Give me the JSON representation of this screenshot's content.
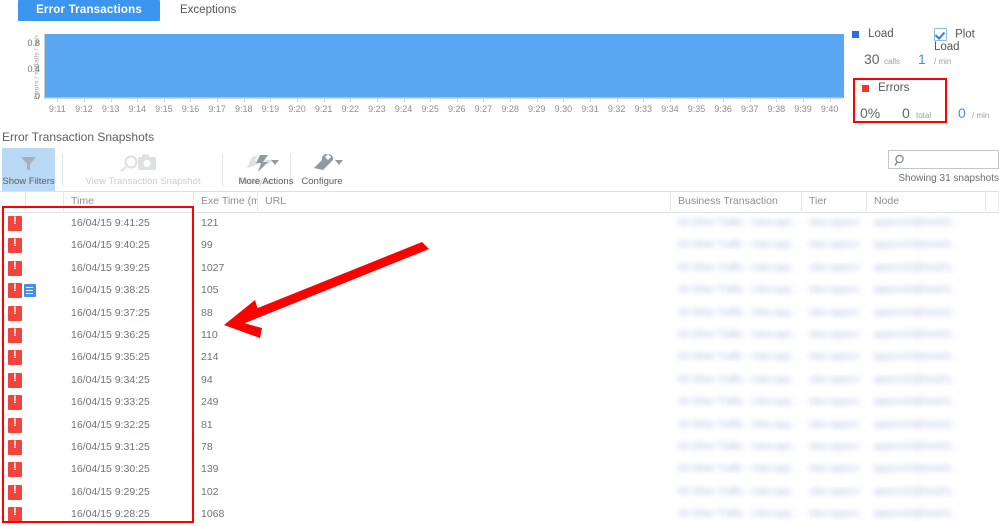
{
  "tabs": [
    {
      "label": "Error Transactions",
      "active": true
    },
    {
      "label": "Exceptions",
      "active": false
    }
  ],
  "chart_data": {
    "type": "area",
    "title": "",
    "xlabel": "",
    "ylabel": "Calls / min",
    "ylabel2": "Errors / min",
    "ylim": [
      0,
      1.0
    ],
    "yticks": [
      "0.8",
      "0.4",
      "0"
    ],
    "grid": false,
    "x": [
      "9:11",
      "9:12",
      "9:13",
      "9:14",
      "9:15",
      "9:16",
      "9:17",
      "9:18",
      "9:19",
      "9:20",
      "9:21",
      "9:22",
      "9:23",
      "9:24",
      "9:25",
      "9:26",
      "9:27",
      "9:28",
      "9:29",
      "9:30",
      "9:31",
      "9:32",
      "9:33",
      "9:34",
      "9:35",
      "9:36",
      "9:37",
      "9:38",
      "9:39",
      "9:40"
    ],
    "series": [
      {
        "name": "Load",
        "color": "#5aa7f3",
        "values": [
          1,
          1,
          1,
          1,
          1,
          1,
          1,
          1,
          1,
          1,
          1,
          1,
          1,
          1,
          1,
          1,
          1,
          1,
          1,
          1,
          1,
          1,
          1,
          1,
          1,
          1,
          1,
          1,
          1,
          1
        ]
      },
      {
        "name": "Errors",
        "color": "#f2a5a5",
        "values": [
          0,
          0,
          0,
          0,
          0,
          0,
          0,
          0,
          0,
          0,
          0,
          0,
          0,
          0,
          0,
          0,
          0,
          0,
          0,
          0,
          0,
          0,
          0,
          0,
          0,
          0,
          0,
          0,
          0,
          0
        ]
      }
    ],
    "legend_position": "right"
  },
  "metrics": {
    "load": {
      "marker_color": "#2e6fd9",
      "label": "Load",
      "checkbox_label": "Plot Load",
      "checkbox_checked": true,
      "value": "30",
      "value_unit": "calls",
      "rate": "1",
      "rate_unit": "/ min"
    },
    "errors": {
      "marker_color": "#f0352e",
      "label": "Errors",
      "percent": "0%",
      "total": "0",
      "total_unit": "total",
      "rate": "0",
      "rate_unit": "/ min",
      "highlight_color": "#ff0000"
    }
  },
  "section": {
    "title": "Error Transaction Snapshots"
  },
  "toolbar": {
    "items": [
      {
        "label": "Show Filters",
        "icon": "filter-funnel-icon",
        "state": "active"
      },
      {
        "label": "View Transaction Snapshot",
        "icon": "magnifier-camera-icon",
        "state": "disabled"
      },
      {
        "label": "Analyze",
        "icon": "analyze-icon",
        "state": "disabled"
      },
      {
        "label": "More Actions",
        "icon": "lightning-bolt-icon",
        "state": "enabled"
      },
      {
        "label": "Configure",
        "icon": "wrench-icon",
        "state": "enabled"
      }
    ]
  },
  "search": {
    "value": "",
    "placeholder": "",
    "icon": "search-icon"
  },
  "showing_text": "Showing 31 snapshots",
  "table": {
    "columns": [
      "",
      "",
      "Time",
      "Exe Time (m",
      "URL",
      "Business Transaction",
      "Tier",
      "Node"
    ],
    "rows": [
      {
        "status": "error",
        "doc": false,
        "time": "16/04/15 9:41:25",
        "exe": "121",
        "url": "",
        "bt": "All Other Traffic - /rdev.app...",
        "tier": "rdev-appsrv",
        "node": "appsrv10@host01..."
      },
      {
        "status": "error",
        "doc": false,
        "time": "16/04/15 9:40:25",
        "exe": "99",
        "url": "",
        "bt": "All Other Traffic - /rdev.app...",
        "tier": "rdev-appsrv",
        "node": "appsrv10@host01..."
      },
      {
        "status": "error",
        "doc": false,
        "time": "16/04/15 9:39:25",
        "exe": "1027",
        "url": "",
        "bt": "All Other Traffic - /rdev.app...",
        "tier": "rdev-appsrv",
        "node": "appsrv10@host01..."
      },
      {
        "status": "error",
        "doc": true,
        "time": "16/04/15 9:38:25",
        "exe": "105",
        "url": "",
        "bt": "All Other Traffic - /rdev.app...",
        "tier": "rdev-appsrv",
        "node": "appsrv10@host01..."
      },
      {
        "status": "error",
        "doc": false,
        "time": "16/04/15 9:37:25",
        "exe": "88",
        "url": "",
        "bt": "All Other Traffic - /rdev.app...",
        "tier": "rdev-appsrv",
        "node": "appsrv10@host01..."
      },
      {
        "status": "error",
        "doc": false,
        "time": "16/04/15 9:36:25",
        "exe": "110",
        "url": "",
        "bt": "All Other Traffic - /rdev.app...",
        "tier": "rdev-appsrv",
        "node": "appsrv10@host01..."
      },
      {
        "status": "error",
        "doc": false,
        "time": "16/04/15 9:35:25",
        "exe": "214",
        "url": "",
        "bt": "All Other Traffic - /rdev.app...",
        "tier": "rdev-appsrv",
        "node": "appsrv10@host01..."
      },
      {
        "status": "error",
        "doc": false,
        "time": "16/04/15 9:34:25",
        "exe": "94",
        "url": "",
        "bt": "All Other Traffic - /rdev.app...",
        "tier": "rdev-appsrv",
        "node": "appsrv10@host01..."
      },
      {
        "status": "error",
        "doc": false,
        "time": "16/04/15 9:33:25",
        "exe": "249",
        "url": "",
        "bt": "All Other Traffic - /rdev.app...",
        "tier": "rdev-appsrv",
        "node": "appsrv10@host01..."
      },
      {
        "status": "error",
        "doc": false,
        "time": "16/04/15 9:32:25",
        "exe": "81",
        "url": "",
        "bt": "All Other Traffic - /rdev.app...",
        "tier": "rdev-appsrv",
        "node": "appsrv10@host01..."
      },
      {
        "status": "error",
        "doc": false,
        "time": "16/04/15 9:31:25",
        "exe": "78",
        "url": "",
        "bt": "All Other Traffic - /rdev.app...",
        "tier": "rdev-appsrv",
        "node": "appsrv10@host01..."
      },
      {
        "status": "error",
        "doc": false,
        "time": "16/04/15 9:30:25",
        "exe": "139",
        "url": "",
        "bt": "All Other Traffic - /rdev.app...",
        "tier": "rdev-appsrv",
        "node": "appsrv10@host01..."
      },
      {
        "status": "error",
        "doc": false,
        "time": "16/04/15 9:29:25",
        "exe": "102",
        "url": "",
        "bt": "All Other Traffic - /rdev.app...",
        "tier": "rdev-appsrv",
        "node": "appsrv10@host01..."
      },
      {
        "status": "error",
        "doc": false,
        "time": "16/04/15 9:28:25",
        "exe": "1068",
        "url": "",
        "bt": "All Other Traffic - /rdev.app...",
        "tier": "rdev-appsrv",
        "node": "appsrv10@host01..."
      }
    ]
  },
  "annotations": {
    "arrow": {
      "color": "#ff0000",
      "points_to": "error-column"
    },
    "row_highlight_color": "#ff0000"
  }
}
